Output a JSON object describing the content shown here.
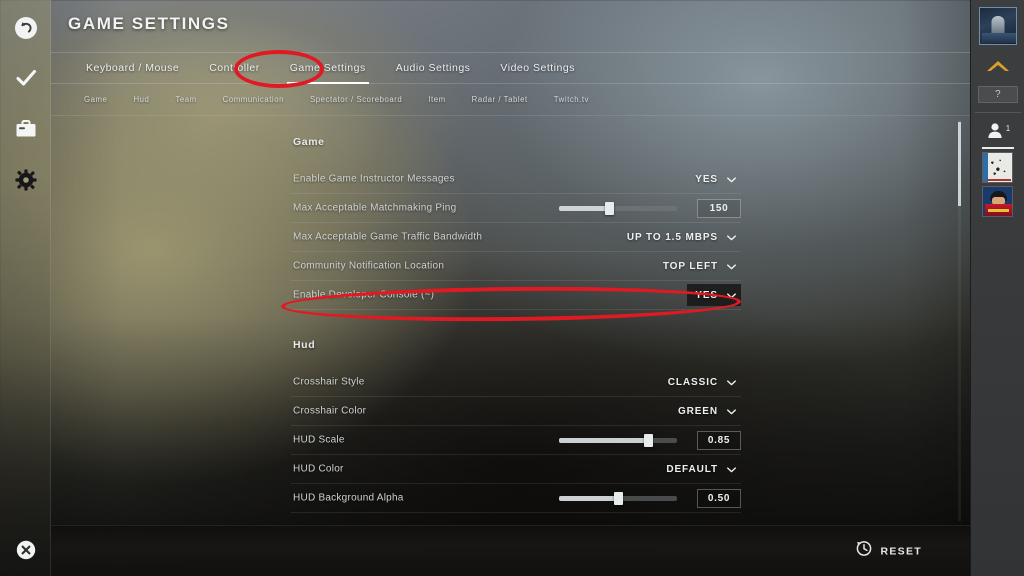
{
  "header": {
    "title": "GAME SETTINGS"
  },
  "left_rail": {
    "items": [
      {
        "name": "back-button",
        "icon": "back-arrow-circle-icon"
      },
      {
        "name": "accept-button",
        "icon": "checkmark-icon"
      },
      {
        "name": "inventory-button",
        "icon": "briefcase-icon"
      },
      {
        "name": "settings-button",
        "icon": "gear-icon"
      }
    ],
    "close": {
      "name": "close-button",
      "icon": "close-circle-icon"
    }
  },
  "right_rail": {
    "help_label": "?",
    "friends_count": "1"
  },
  "tabs": [
    {
      "label": "Keyboard / Mouse",
      "active": false
    },
    {
      "label": "Controller",
      "active": false
    },
    {
      "label": "Game Settings",
      "active": true
    },
    {
      "label": "Audio Settings",
      "active": false
    },
    {
      "label": "Video Settings",
      "active": false
    }
  ],
  "subtabs": [
    {
      "label": "Game"
    },
    {
      "label": "Hud"
    },
    {
      "label": "Team"
    },
    {
      "label": "Communication"
    },
    {
      "label": "Spectator / Scoreboard"
    },
    {
      "label": "Item"
    },
    {
      "label": "Radar / Tablet"
    },
    {
      "label": "Twitch.tv"
    }
  ],
  "sections": [
    {
      "title": "Game",
      "rows": [
        {
          "label": "Enable Game Instructor Messages",
          "type": "dropdown",
          "value": "YES",
          "highlighted": false
        },
        {
          "label": "Max Acceptable Matchmaking Ping",
          "type": "slider",
          "value": "150",
          "percent": 42
        },
        {
          "label": "Max Acceptable Game Traffic Bandwidth",
          "type": "dropdown",
          "value": "UP TO 1.5 MBPS",
          "highlighted": false
        },
        {
          "label": "Community Notification Location",
          "type": "dropdown",
          "value": "TOP LEFT",
          "highlighted": false
        },
        {
          "label": "Enable Developer Console (~)",
          "type": "dropdown",
          "value": "YES",
          "highlighted": true
        }
      ]
    },
    {
      "title": "Hud",
      "rows": [
        {
          "label": "Crosshair Style",
          "type": "dropdown",
          "value": "CLASSIC",
          "highlighted": false
        },
        {
          "label": "Crosshair Color",
          "type": "dropdown",
          "value": "GREEN",
          "highlighted": false
        },
        {
          "label": "HUD Scale",
          "type": "slider",
          "value": "0.85",
          "percent": 75
        },
        {
          "label": "HUD Color",
          "type": "dropdown",
          "value": "DEFAULT",
          "highlighted": false
        },
        {
          "label": "HUD Background Alpha",
          "type": "slider",
          "value": "0.50",
          "percent": 50
        }
      ]
    }
  ],
  "footer": {
    "reset_label": "RESET"
  },
  "annotations": {
    "color": "#e01a22",
    "marks": [
      {
        "name": "annotation-ellipse-game-settings-tab",
        "target": "Game Settings"
      },
      {
        "name": "annotation-ellipse-enable-developer-console",
        "target": "Enable Developer Console (~)"
      }
    ]
  },
  "colors": {
    "accent_red": "#e01a22",
    "text_primary": "#eef0f0",
    "text_secondary": "#cfd2d2"
  }
}
